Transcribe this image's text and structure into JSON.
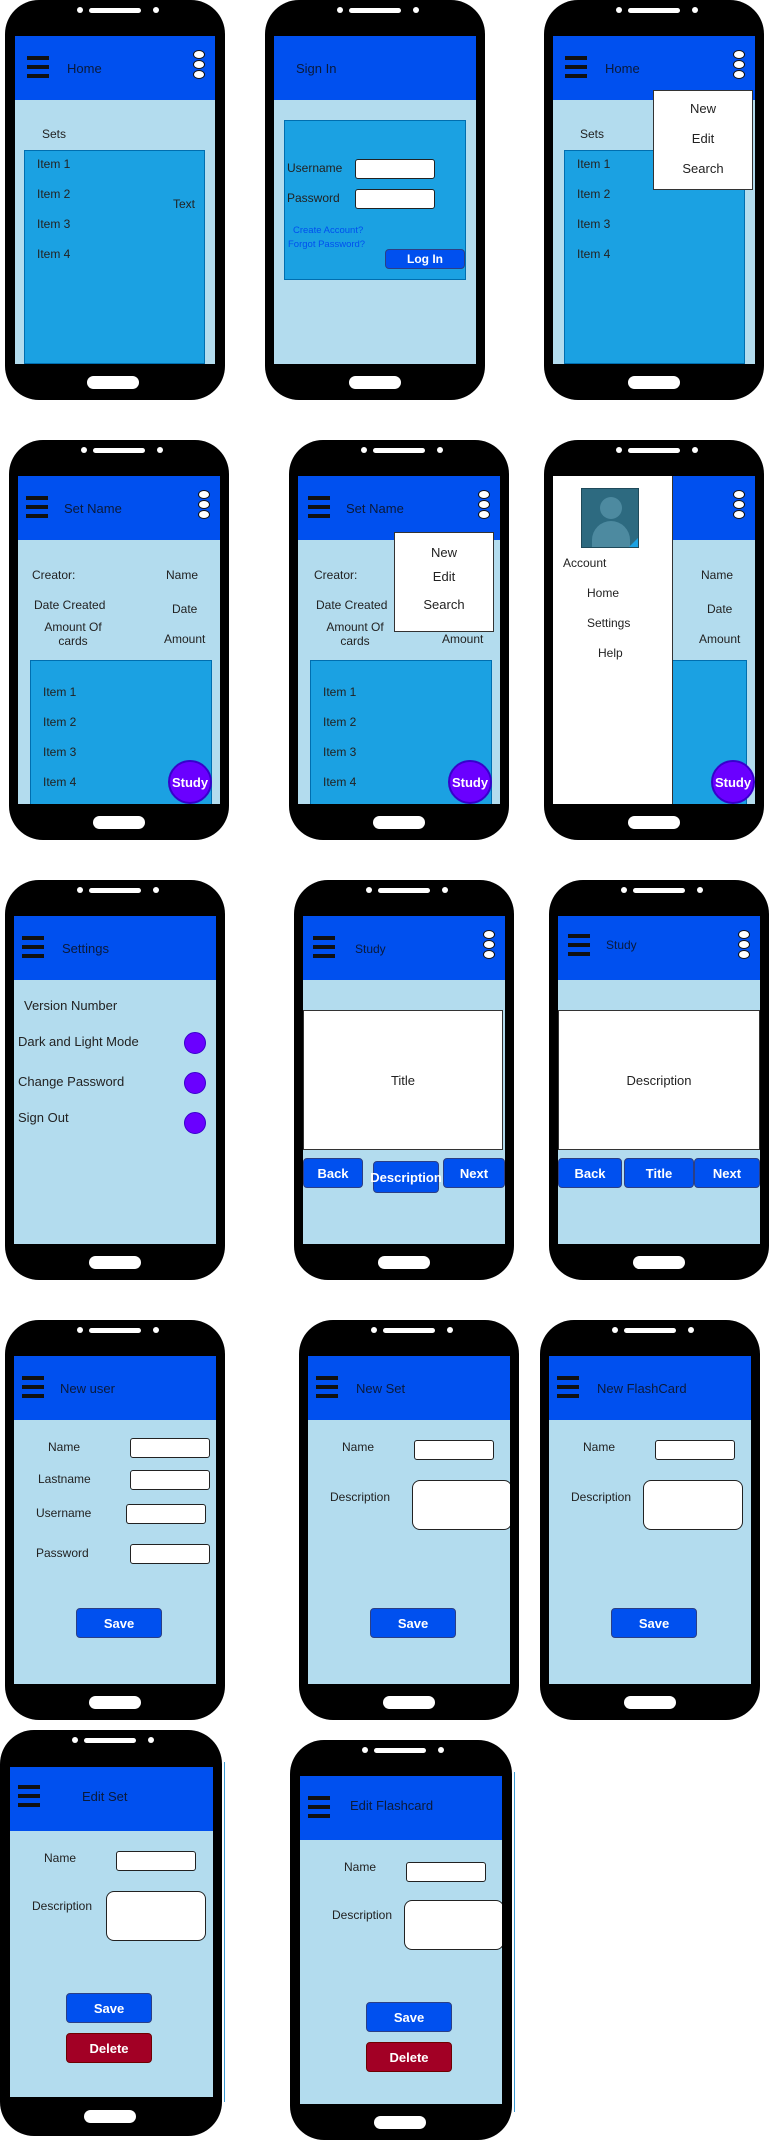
{
  "home": {
    "title": "Home",
    "sets_label": "Sets",
    "items": [
      "Item 1",
      "Item 2",
      "Item 3",
      "Item 4"
    ],
    "text_label": "Text"
  },
  "signin": {
    "title": "Sign In",
    "username_label": "Username",
    "password_label": "Password",
    "create_account": "Create Account?",
    "forgot_password": "Forgot Password?",
    "login_button": "Log In"
  },
  "home_menu": {
    "title": "Home",
    "sets_label": "Sets",
    "items": [
      "Item 1",
      "Item 2",
      "Item 3",
      "Item 4"
    ],
    "menu": [
      "New",
      "Edit",
      "Search"
    ]
  },
  "set_view": {
    "title": "Set Name",
    "creator_label": "Creator:",
    "creator_value": "Name",
    "date_label": "Date Created",
    "date_value": "Date",
    "amount_label": "Amount Of cards",
    "amount_value": "Amount",
    "items": [
      "Item 1",
      "Item 2",
      "Item 3",
      "Item 4"
    ],
    "study_button": "Study"
  },
  "set_menu": {
    "title": "Set Name",
    "creator_label": "Creator:",
    "date_label": "Date Created",
    "amount_label": "Amount Of cards",
    "amount_value": "Amount",
    "items": [
      "Item 1",
      "Item 2",
      "Item 3",
      "Item 4"
    ],
    "study_button": "Study",
    "menu": [
      "New",
      "Edit",
      "Search"
    ]
  },
  "drawer": {
    "nav": [
      "Account",
      "Home",
      "Settings",
      "Help"
    ],
    "name_value": "Name",
    "date_value": "Date",
    "amount_value": "Amount",
    "study_button": "Study"
  },
  "settings": {
    "title": "Settings",
    "version": "Version Number",
    "dark_mode": "Dark and Light Mode",
    "change_password": "Change Password",
    "sign_out": "Sign Out"
  },
  "study_title": {
    "title": "Study",
    "card_text": "Title",
    "back": "Back",
    "flip": "Description",
    "next": "Next"
  },
  "study_desc": {
    "title": "Study",
    "card_text": "Description",
    "back": "Back",
    "flip": "Title",
    "next": "Next"
  },
  "new_user": {
    "title": "New user",
    "name": "Name",
    "lastname": "Lastname",
    "username": "Username",
    "password": "Password",
    "save": "Save"
  },
  "new_set": {
    "title": "New Set",
    "name": "Name",
    "description": "Description",
    "save": "Save"
  },
  "new_flashcard": {
    "title": "New FlashCard",
    "name": "Name",
    "description": "Description",
    "save": "Save"
  },
  "edit_set": {
    "title": "Edit Set",
    "name": "Name",
    "description": "Description",
    "save": "Save",
    "delete": "Delete"
  },
  "edit_flashcard": {
    "title": "Edit Flashcard",
    "name": "Name",
    "description": "Description",
    "save": "Save",
    "delete": "Delete"
  },
  "colors": {
    "app_bar": "#0050ef",
    "screen": "#b3dcee",
    "panel": "#1ba1e2",
    "study_fab": "#6a00ff",
    "delete": "#a20025"
  }
}
